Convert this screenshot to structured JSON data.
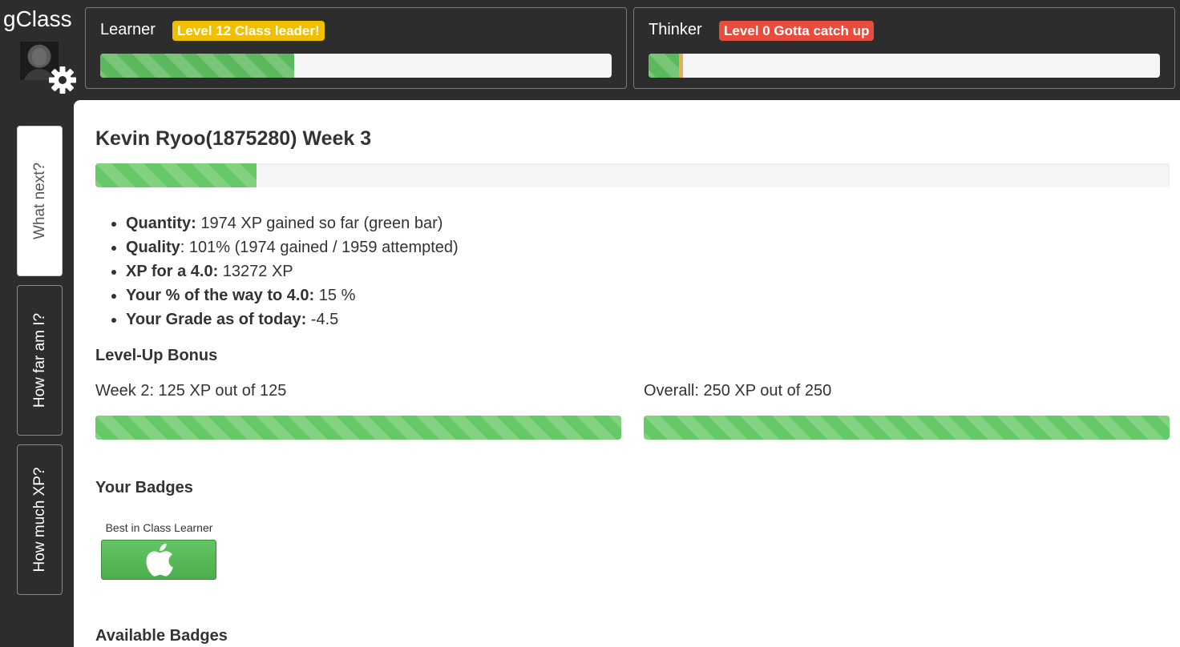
{
  "app": {
    "brand": "gClass",
    "avatar": "user-avatar",
    "settings_icon": "gear-icon"
  },
  "side_tabs": [
    {
      "label": "What next?",
      "active": true
    },
    {
      "label": "How far am I?",
      "active": false
    },
    {
      "label": "How much XP?",
      "active": false
    }
  ],
  "skills": [
    {
      "name": "Learner",
      "badge": "Level 12  Class leader!",
      "badge_color": "#f0c000",
      "progress": 0.38
    },
    {
      "name": "Thinker",
      "badge": "Level 0  Gotta catch up",
      "badge_color": "#e74c3c",
      "progress": 0.06,
      "marker_color": "#f0ad4e"
    }
  ],
  "main": {
    "title": "Kevin Ryoo(1875280) Week 3",
    "overall_progress_percent": 15,
    "stats": [
      {
        "label": "Quantity:",
        "value": " 1974 XP gained so far (green bar)"
      },
      {
        "label": "Quality",
        "value": ": 101% (1974 gained / 1959 attempted)"
      },
      {
        "label": "XP for a 4.0:",
        "value": " 13272 XP"
      },
      {
        "label": "Your % of the way to 4.0:",
        "value": " 15 %"
      },
      {
        "label": "Your Grade as of today:",
        "value": " -4.5"
      }
    ],
    "level_up": {
      "heading": "Level-Up Bonus",
      "week": {
        "label": "Week 2: 125 XP out of 125",
        "progress": 1.0
      },
      "overall": {
        "label": "Overall: 250 XP out of 250",
        "progress": 1.0
      }
    },
    "badges": {
      "heading": "Your Badges",
      "items": [
        {
          "caption": "Best in Class Learner",
          "icon": "apple-icon",
          "color": "#5cb85c"
        }
      ]
    },
    "available_heading": "Available Badges"
  }
}
